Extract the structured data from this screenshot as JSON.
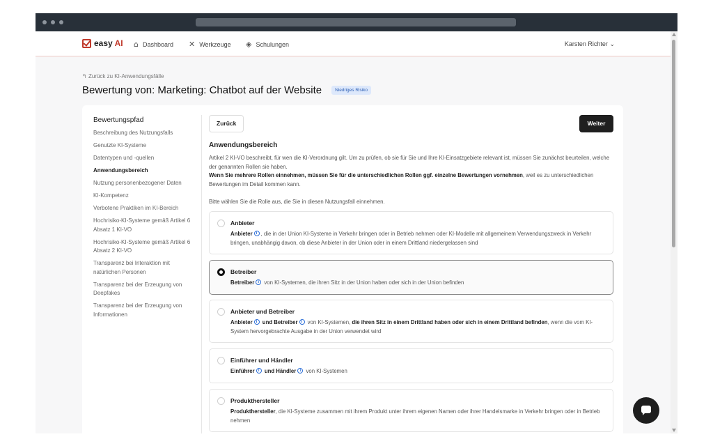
{
  "nav": {
    "logo_prefix": "easy ",
    "logo_ai": "AI",
    "items": [
      {
        "label": "Dashboard",
        "icon": "home-icon"
      },
      {
        "label": "Werkzeuge",
        "icon": "tools-icon"
      },
      {
        "label": "Schulungen",
        "icon": "graduation-cap-icon"
      }
    ],
    "user": "Karsten Richter"
  },
  "header": {
    "back_link": "Zurück zu KI-Anwendungsfälle",
    "title": "Bewertung von: Marketing: Chatbot auf der Website",
    "risk_badge": "Niedriges Risiko"
  },
  "sidebar": {
    "heading": "Bewertungspfad",
    "items": [
      "Beschreibung des Nutzungsfalls",
      "Genutzte KI-Systeme",
      "Datentypen und -quellen",
      "Anwendungsbereich",
      "Nutzung personenbezogener Daten",
      "KI-Kompetenz",
      "Verbotene Praktiken im KI-Bereich",
      "Hochrisiko-KI-Systeme gemäß Artikel 6 Absatz 1 KI-VO",
      "Hochrisiko-KI-Systeme gemäß Artikel 6 Absatz 2 KI-VO",
      "Transparenz bei Interaktion mit natürlichen Personen",
      "Transparenz bei der Erzeugung von Deepfakes",
      "Transparenz bei der Erzeugung von Informationen"
    ],
    "active_index": 3
  },
  "content": {
    "back_button": "Zurück",
    "next_button": "Weiter",
    "section_title": "Anwendungsbereich",
    "desc_1": "Artikel 2 KI-VO beschreibt, für wen die KI-Verordnung gilt. Um zu prüfen, ob sie für Sie und Ihre KI-Einsatzgebiete relevant ist, müssen Sie zunächst beurteilen, welche der genannten Rollen sie haben.",
    "desc_2_bold": "Wenn Sie mehrere Rollen einnehmen, müssen Sie für die unterschiedlichen Rollen ggf. einzelne Bewertungen vornehmen",
    "desc_2_rest": ", weil es zu unterschiedlichen Bewertungen im Detail kommen kann.",
    "prompt": "Bitte wählen Sie die Rolle aus, die Sie in diesen Nutzungsfall einnehmen.",
    "info_glyph": "i",
    "options": [
      {
        "title": "Anbieter",
        "term1": "Anbieter",
        "text": ", die in der Union KI-Systeme in Verkehr bringen oder in Betrieb nehmen oder KI-Modelle mit allgemeinem Verwendungszweck in Verkehr bringen, unabhängig davon, ob diese Anbieter in der Union oder in einem Drittland niedergelassen sind"
      },
      {
        "title": "Betreiber",
        "term1": "Betreiber",
        "text": " von KI-Systemen, die ihren Sitz in der Union haben oder sich in der Union befinden",
        "selected": true
      },
      {
        "title": "Anbieter und Betreiber",
        "term1": "Anbieter",
        "joiner": " und Betreiber",
        "text_a": " von KI-Systemen, ",
        "text_bold": "die ihren Sitz in einem Drittland haben oder sich in einem Drittland befinden",
        "text_b": ", wenn die vom KI-System hervorgebrachte Ausgabe in der Union verwendet wird"
      },
      {
        "title": "Einführer und Händler",
        "term1": "Einführer",
        "joiner": " und Händler",
        "text": " von KI-Systemen"
      },
      {
        "title": "Produkthersteller",
        "term1": "Produkthersteller",
        "text": ", die KI-Systeme zusammen mit ihrem Produkt unter ihrem eigenen Namen oder ihrer Handelsmarke in Verkehr bringen oder in Betrieb nehmen"
      }
    ]
  },
  "colors": {
    "brand_red": "#c0392b",
    "badge_bg": "#dde8fb",
    "badge_text": "#2d5fb5",
    "primary_button": "#1f1f1f",
    "info_blue": "#2d6fd8"
  }
}
